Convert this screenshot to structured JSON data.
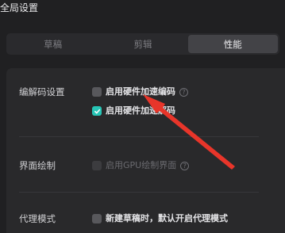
{
  "header": {
    "title": "全局设置"
  },
  "tabs": [
    {
      "label": "草稿",
      "active": false
    },
    {
      "label": "剪辑",
      "active": false
    },
    {
      "label": "性能",
      "active": true
    }
  ],
  "sections": {
    "codec": {
      "label": "编解码设置",
      "options": [
        {
          "text": "启用硬件加速编码",
          "checked": false,
          "help": "?"
        },
        {
          "text": "启用硬件加速解码",
          "checked": true
        }
      ]
    },
    "render": {
      "label": "界面绘制",
      "options": [
        {
          "text": "启用GPU绘制界面",
          "checked": false,
          "disabled": true,
          "help": "?"
        }
      ]
    },
    "proxy": {
      "label": "代理模式",
      "options": [
        {
          "text": "新建草稿时，默认开启代理模式",
          "checked": false
        }
      ]
    }
  },
  "colors": {
    "background": "#202022",
    "panel": "#29292b",
    "accent": "#27c5b6",
    "annotation_arrow": "#e8352a"
  },
  "icons": {
    "help": "question-circle-icon",
    "check": "checkmark-icon",
    "annotation": "red-arrow-annotation"
  }
}
